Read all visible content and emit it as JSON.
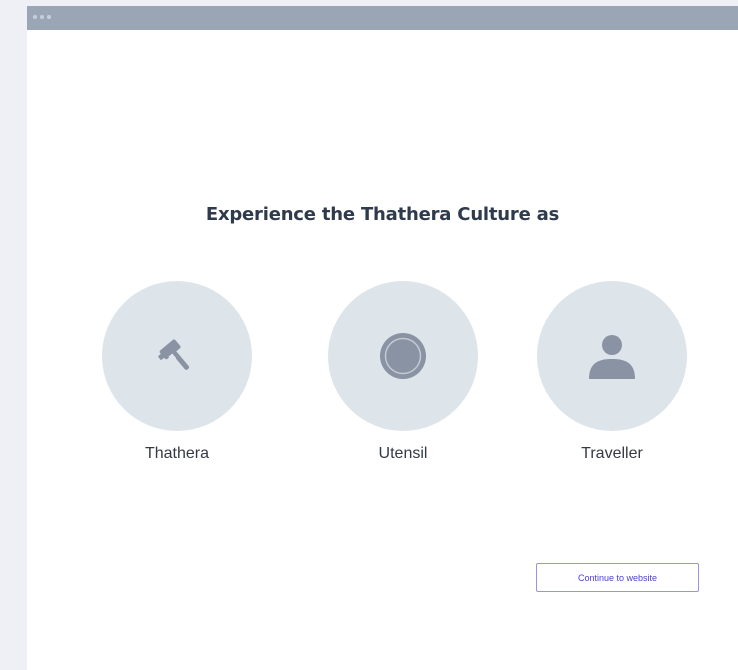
{
  "main": {
    "heading": "Experience the Thathera Culture as",
    "options": [
      {
        "label": "Thathera",
        "icon": "hammer-icon"
      },
      {
        "label": "Utensil",
        "icon": "plate-icon"
      },
      {
        "label": "Traveller",
        "icon": "person-icon"
      }
    ],
    "continue_label": "Continue to website"
  },
  "colors": {
    "titlebar": "#9aa5b6",
    "circle_bg": "#dde4ea",
    "icon": "#8a93a3",
    "button_border": "#9b94e6",
    "button_text": "#4a3fd0"
  }
}
